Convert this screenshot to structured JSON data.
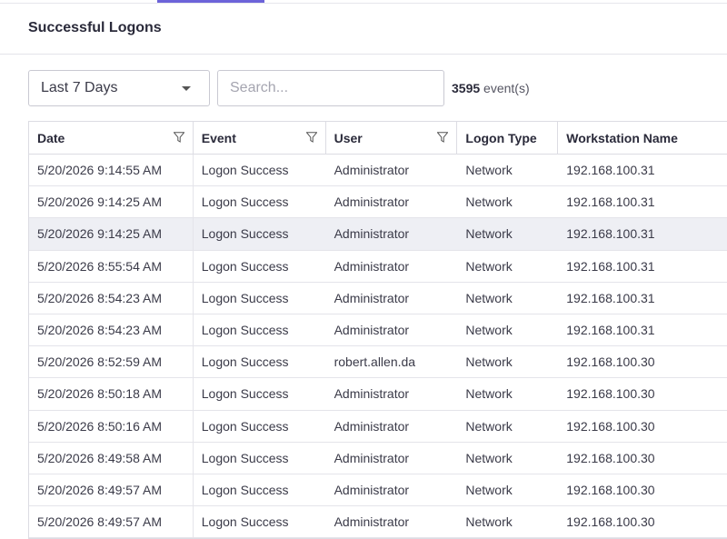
{
  "page": {
    "title": "Successful Logons"
  },
  "toolbar": {
    "range_value": "Last 7 Days",
    "search_placeholder": "Search...",
    "count_number": "3595",
    "count_suffix": " event(s)"
  },
  "table": {
    "columns": [
      "Date",
      "Event",
      "User",
      "Logon Type",
      "Workstation Name"
    ],
    "rows": [
      [
        "5/20/2026 9:14:55 AM",
        "Logon Success",
        "Administrator",
        "Network",
        "192.168.100.31"
      ],
      [
        "5/20/2026 9:14:25 AM",
        "Logon Success",
        "Administrator",
        "Network",
        "192.168.100.31"
      ],
      [
        "5/20/2026 9:14:25 AM",
        "Logon Success",
        "Administrator",
        "Network",
        "192.168.100.31"
      ],
      [
        "5/20/2026 8:55:54 AM",
        "Logon Success",
        "Administrator",
        "Network",
        "192.168.100.31"
      ],
      [
        "5/20/2026 8:54:23 AM",
        "Logon Success",
        "Administrator",
        "Network",
        "192.168.100.31"
      ],
      [
        "5/20/2026 8:54:23 AM",
        "Logon Success",
        "Administrator",
        "Network",
        "192.168.100.31"
      ],
      [
        "5/20/2026 8:52:59 AM",
        "Logon Success",
        "robert.allen.da",
        "Network",
        "192.168.100.30"
      ],
      [
        "5/20/2026 8:50:18 AM",
        "Logon Success",
        "Administrator",
        "Network",
        "192.168.100.30"
      ],
      [
        "5/20/2026 8:50:16 AM",
        "Logon Success",
        "Administrator",
        "Network",
        "192.168.100.30"
      ],
      [
        "5/20/2026 8:49:58 AM",
        "Logon Success",
        "Administrator",
        "Network",
        "192.168.100.30"
      ],
      [
        "5/20/2026 8:49:57 AM",
        "Logon Success",
        "Administrator",
        "Network",
        "192.168.100.30"
      ],
      [
        "5/20/2026 8:49:57 AM",
        "Logon Success",
        "Administrator",
        "Network",
        "192.168.100.30"
      ]
    ],
    "highlighted_row": 2
  },
  "colors": {
    "accent": "#6c63d9",
    "row_highlight": "#eeeff4"
  },
  "icons": {
    "filter": "filter-funnel-icon",
    "dropdown": "chevron-down-icon"
  }
}
